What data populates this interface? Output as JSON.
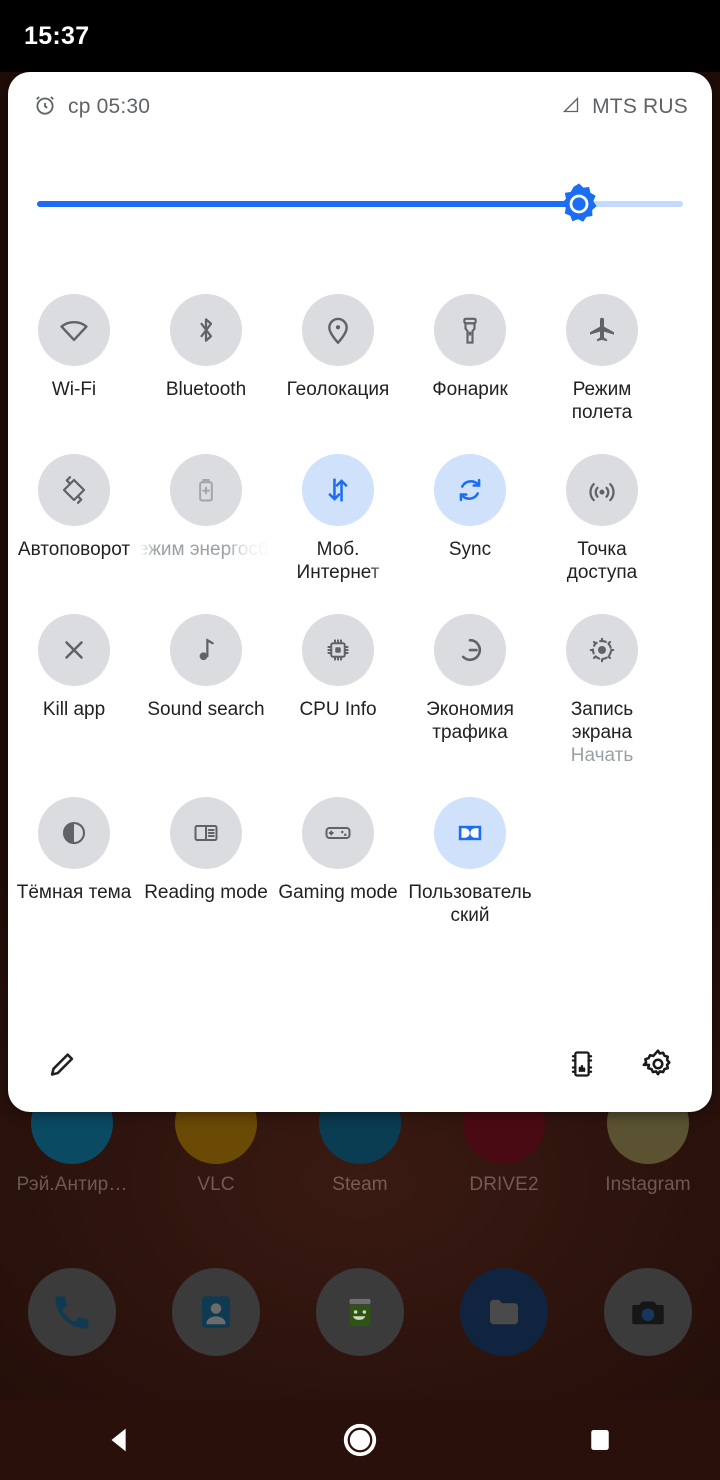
{
  "status_bar": {
    "clock": "15:37"
  },
  "colors": {
    "accent": "#1b6ef3",
    "tile_on_bg": "#cfe1fb",
    "tile_off_bg": "#dadce0",
    "icon_off": "#5f6368",
    "panel_bg": "#ffffff",
    "wallpaper": "#2c140d"
  },
  "panel": {
    "status_row": {
      "alarm_icon": "alarm-icon",
      "alarm_text": "ср 05:30",
      "signal_icon": "signal-cellular-icon",
      "carrier": "MTS RUS"
    },
    "brightness": {
      "label": "brightness-slider",
      "value_percent": 84,
      "icon": "brightness-sun-icon"
    },
    "tiles": [
      {
        "label": "Wi-Fi",
        "icon": "wifi-icon",
        "state": "off"
      },
      {
        "label": "Bluetooth",
        "icon": "bluetooth-icon",
        "state": "off"
      },
      {
        "label": "Геолокация",
        "icon": "location-pin-icon",
        "state": "off"
      },
      {
        "label": "Фонарик",
        "icon": "flashlight-icon",
        "state": "off"
      },
      {
        "label": "Режим полета",
        "icon": "airplane-icon",
        "state": "off"
      },
      {
        "label": "Автоповорот",
        "icon": "auto-rotate-icon",
        "state": "off"
      },
      {
        "label": "Режим энергосбережения",
        "icon": "battery-saver-icon",
        "state": "off",
        "label_clipped": true
      },
      {
        "label": "Моб. Интернет",
        "icon": "mobile-data-icon",
        "state": "on"
      },
      {
        "label": "Sync",
        "icon": "sync-icon",
        "state": "on"
      },
      {
        "label": "Точка доступа",
        "icon": "hotspot-icon",
        "state": "off"
      },
      {
        "label": "Kill app",
        "icon": "close-x-icon",
        "state": "off"
      },
      {
        "label": "Sound search",
        "icon": "music-note-icon",
        "state": "off"
      },
      {
        "label": "CPU Info",
        "icon": "cpu-chip-icon",
        "state": "off"
      },
      {
        "label": "Экономия трафика",
        "icon": "data-saver-icon",
        "state": "off"
      },
      {
        "label": "Запись экрана",
        "sub": "Начать",
        "icon": "screen-record-icon",
        "state": "off",
        "label_fade": true
      },
      {
        "label": "Тёмная тема",
        "icon": "dark-theme-icon",
        "state": "off"
      },
      {
        "label": "Reading mode",
        "icon": "reading-mode-icon",
        "state": "off"
      },
      {
        "label": "Gaming mode",
        "icon": "gamepad-icon",
        "state": "off"
      },
      {
        "label": "Пользовательский",
        "icon": "dolby-icon",
        "state": "on"
      }
    ],
    "footer": {
      "edit_label": "edit-pencil-icon",
      "cpu_label": "chip-icon",
      "settings_label": "gear-icon"
    }
  },
  "home_screen": {
    "app_row": [
      {
        "label": "Рэй.Антир…",
        "icon": "antivirus-app-icon",
        "color": "#0b4a63"
      },
      {
        "label": "VLC",
        "icon": "vlc-app-icon",
        "color": "#6b4a05"
      },
      {
        "label": "Steam",
        "icon": "steam-app-icon",
        "color": "#0a3c52"
      },
      {
        "label": "DRIVE2",
        "icon": "drive2-app-icon",
        "color": "#4a0a14"
      },
      {
        "label": "Instagram",
        "icon": "instagram-app-icon",
        "color": "#5a5230"
      }
    ],
    "dock": [
      {
        "icon": "phone-app-icon",
        "color": "#3a3a3a"
      },
      {
        "icon": "contacts-app-icon",
        "color": "#3a3a3a"
      },
      {
        "icon": "play-store-app-icon",
        "color": "#3a3a3a"
      },
      {
        "icon": "files-app-icon",
        "color": "#10243f"
      },
      {
        "icon": "camera-app-icon",
        "color": "#3a3a3a"
      }
    ]
  },
  "nav_bar": {
    "back": "back-triangle-icon",
    "home": "home-circle-icon",
    "recents": "recents-square-icon"
  }
}
